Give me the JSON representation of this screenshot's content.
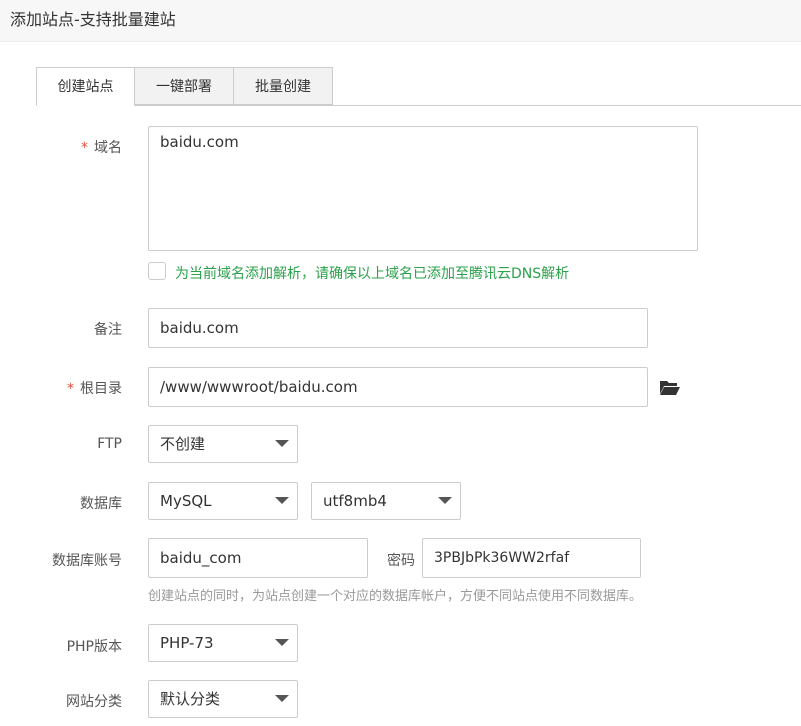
{
  "window": {
    "title": "添加站点-支持批量建站"
  },
  "tabs": [
    {
      "label": "创建站点",
      "active": true
    },
    {
      "label": "一键部署"
    },
    {
      "label": "批量创建"
    }
  ],
  "form": {
    "required_mark": "*",
    "domain": {
      "label": "域名",
      "value": "baidu.com"
    },
    "dns": {
      "checked": false,
      "hint": "为当前域名添加解析，请确保以上域名已添加至腾讯云DNS解析"
    },
    "remark": {
      "label": "备注",
      "value": "baidu.com"
    },
    "root": {
      "label": "根目录",
      "value": "/www/wwwroot/baidu.com",
      "icon": "folder-open-icon"
    },
    "ftp": {
      "label": "FTP",
      "selected": "不创建"
    },
    "database": {
      "label": "数据库",
      "type_selected": "MySQL",
      "charset_selected": "utf8mb4"
    },
    "db_account": {
      "label": "数据库账号",
      "value": "baidu_com",
      "password_label": "密码",
      "password_value": "3PBJbPk36WW2rfaf",
      "hint": "创建站点的同时，为站点创建一个对应的数据库帐户，方便不同站点使用不同数据库。"
    },
    "php": {
      "label": "PHP版本",
      "selected": "PHP-73"
    },
    "category": {
      "label": "网站分类",
      "selected": "默认分类"
    }
  },
  "colors": {
    "required": "#e94e3d",
    "hint_green": "#2aa14a",
    "hint_gray": "#999999"
  }
}
